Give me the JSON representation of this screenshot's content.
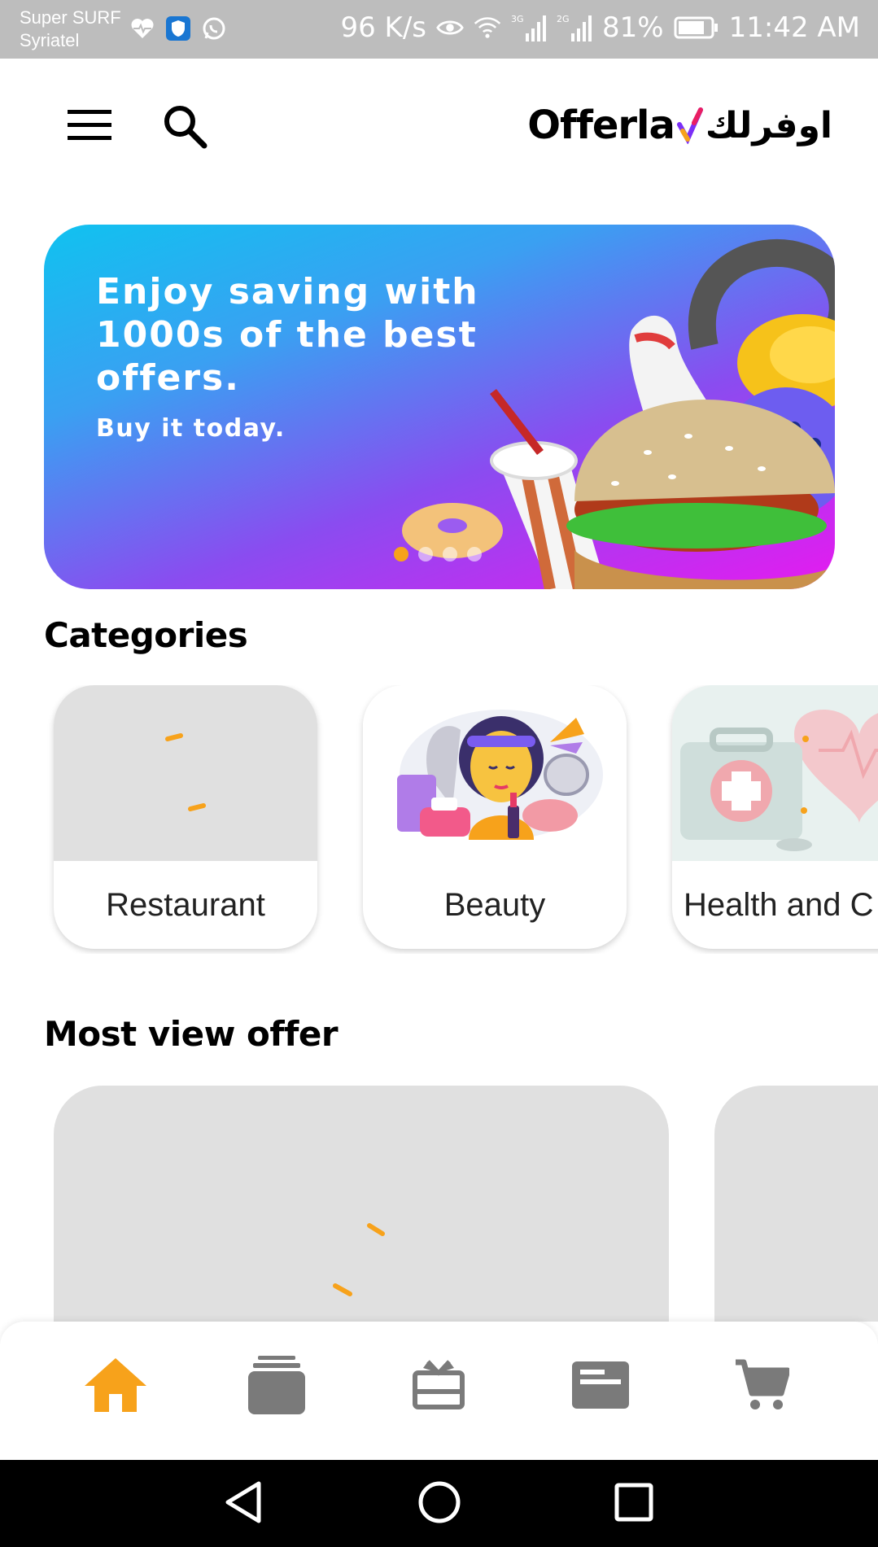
{
  "status_bar": {
    "carrier_line1": "Super SURF",
    "carrier_line2": "Syriatel",
    "net_speed": "96 K/s",
    "network_3g": "3G",
    "network_2g": "2G",
    "battery": "81%",
    "time": "11:42 AM",
    "icons": [
      "heart-pulse-icon",
      "shield-icon",
      "whatsapp-icon",
      "eye-icon",
      "wifi-icon",
      "signal-icon",
      "signal-icon",
      "battery-icon"
    ]
  },
  "header": {
    "logo_en": "Offerla",
    "logo_ar": "اوفرلك",
    "menu_icon": "hamburger-menu-icon",
    "search_icon": "search-icon"
  },
  "banner": {
    "headline": "Enjoy saving with 1000s of the best offers.",
    "subline": "Buy it today.",
    "slide_count": 4,
    "active_slide": 1
  },
  "categories": {
    "title": "Categories",
    "items": [
      {
        "label": "Restaurant"
      },
      {
        "label": "Beauty"
      },
      {
        "label": "Health and C"
      }
    ]
  },
  "offers": {
    "title": "Most view offer"
  },
  "bottom_nav": {
    "items": [
      "home-icon",
      "stack-icon",
      "gift-icon",
      "card-icon",
      "cart-icon"
    ],
    "active": "home-icon"
  },
  "colors": {
    "accent": "#F7A21B",
    "inactive_icon": "#7A7A7A",
    "placeholder": "#E0E0E0",
    "status_bar": "#BDBDBD"
  }
}
